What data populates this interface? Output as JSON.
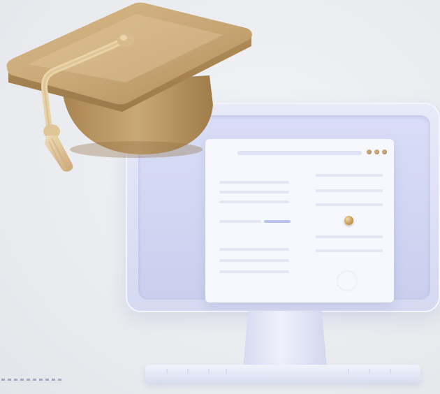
{
  "scene": {
    "subjects": [
      "graduation-cap",
      "computer-monitor"
    ],
    "colors": {
      "background": "#eceef2",
      "cap_gold": "#c8a574",
      "monitor_frame": "#d5d9f1",
      "screen_window": "#f7f8fd",
      "accent_line": "#b9c2ea",
      "knob_gold": "#c99a55"
    },
    "window_dots": 3
  }
}
